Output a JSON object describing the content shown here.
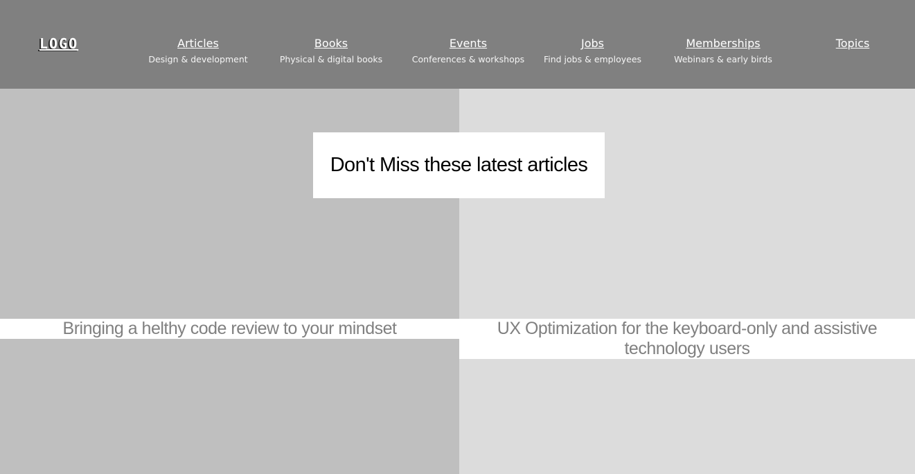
{
  "header": {
    "logo_text": "LOGO",
    "nav": [
      {
        "label": "Articles",
        "description": "Design & development"
      },
      {
        "label": "Books",
        "description": "Physical & digital books"
      },
      {
        "label": "Events",
        "description": "Conferences & workshops"
      },
      {
        "label": "Jobs",
        "description": "Find jobs & employees"
      },
      {
        "label": "Memberships",
        "description": "Webinars & early birds"
      },
      {
        "label": "Topics",
        "description": ""
      }
    ]
  },
  "main": {
    "heading": "Don't Miss these latest articles",
    "articles": [
      {
        "title": "Bringing a helthy code review to your mindset"
      },
      {
        "title": "UX Optimization for the keyboard-only and assistive technology users"
      }
    ]
  },
  "colors": {
    "header_bg": "#808080",
    "left_panel_bg": "#bfbfbf",
    "right_panel_bg": "#dcdcdc",
    "article_title_text": "#808080"
  }
}
